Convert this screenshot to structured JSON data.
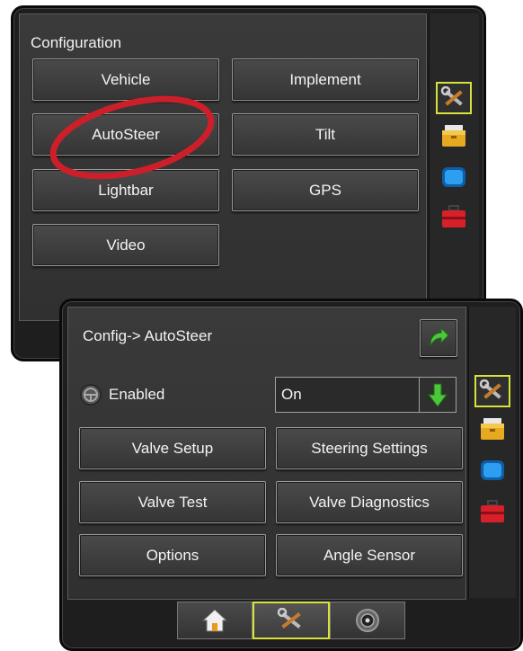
{
  "top_panel": {
    "title": "Configuration",
    "buttons": [
      "Vehicle",
      "Implement",
      "AutoSteer",
      "Tilt",
      "Lightbar",
      "GPS",
      "Video"
    ]
  },
  "bottom_panel": {
    "title": "Config-> AutoSteer",
    "enabled_label": "Enabled",
    "enabled_value": "On",
    "buttons": [
      "Valve Setup",
      "Steering Settings",
      "Valve Test",
      "Valve Diagnostics",
      "Options",
      "Angle Sensor"
    ]
  },
  "side_icons": [
    "tools-icon",
    "folder-icon",
    "monitor-icon",
    "toolbox-icon"
  ],
  "bottom_tabs": [
    "home-icon",
    "tools-icon",
    "gauge-icon"
  ],
  "colors": {
    "highlight": "#d8e23a",
    "annotation": "#cc1f2a",
    "accent_green": "#3fae3a"
  }
}
